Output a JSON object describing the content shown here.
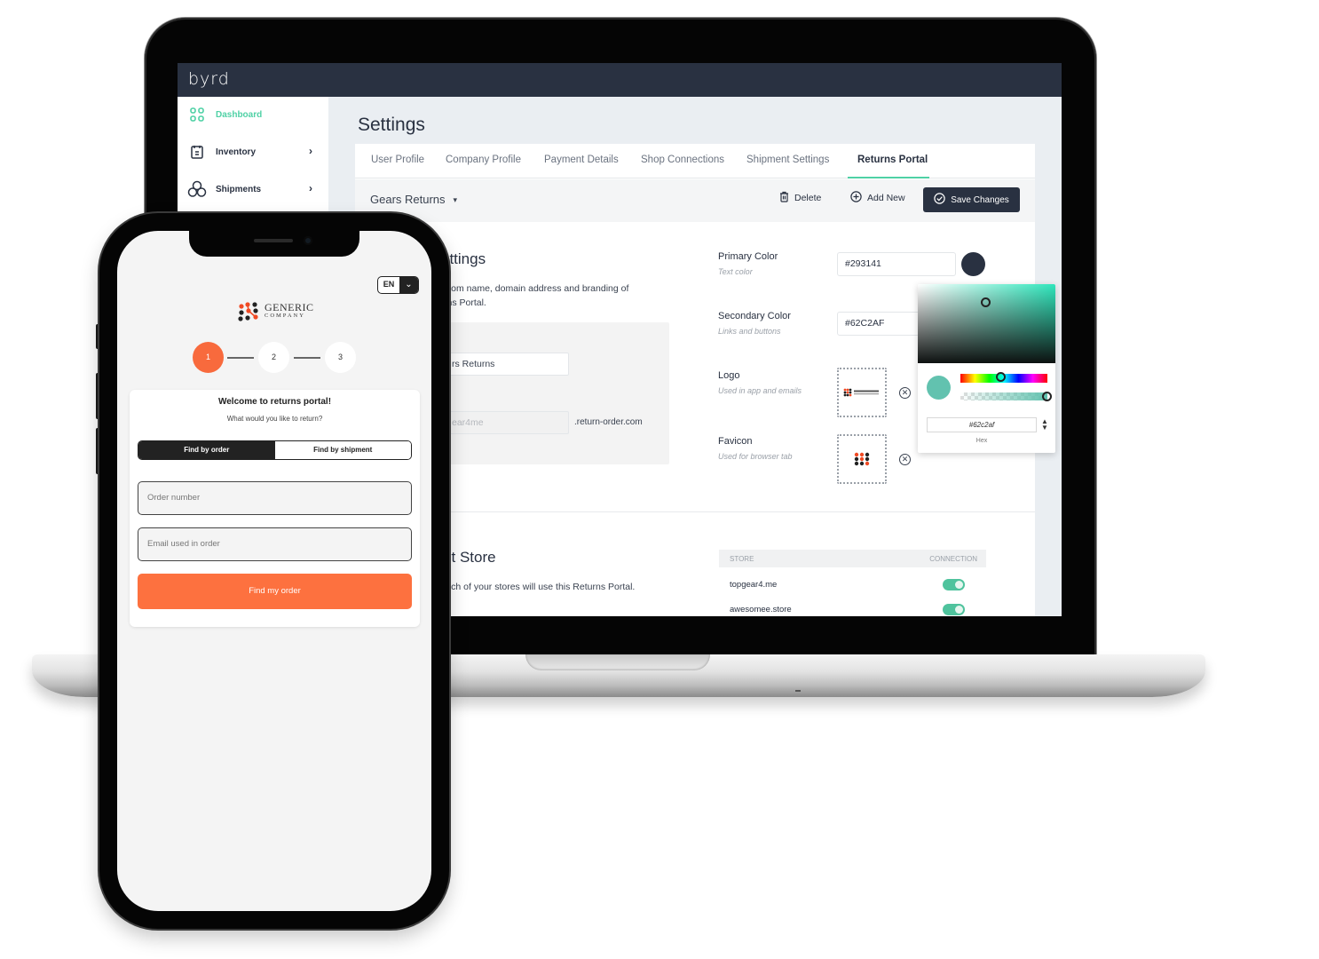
{
  "desktop": {
    "app_logo": "byrd",
    "sidebar": {
      "items": [
        {
          "label": "Dashboard",
          "icon": "dashboard-grid-icon",
          "active": true
        },
        {
          "label": "Inventory",
          "icon": "inventory-clipboard-icon",
          "has_children": true
        },
        {
          "label": "Shipments",
          "icon": "shipments-boxes-icon",
          "has_children": true
        }
      ],
      "chevron": "›"
    },
    "page_title": "Settings",
    "tabs": [
      {
        "label": "User Profile"
      },
      {
        "label": "Company Profile"
      },
      {
        "label": "Payment Details"
      },
      {
        "label": "Shop Connections"
      },
      {
        "label": "Shipment Settings"
      },
      {
        "label": "Returns Portal",
        "active": true
      }
    ],
    "toolbar": {
      "portal_select": "Gears Returns",
      "caret": "▾",
      "delete_label": "Delete",
      "add_new_label": "Add New",
      "save_label": "Save Changes"
    },
    "portal_settings": {
      "title_visible": "ettings",
      "desc_line1": "stom name, domain address and branding of",
      "desc_line2": "rns Portal.",
      "name_value": "rs Returns",
      "domain_placeholder": "ear4me",
      "domain_suffix": ".return-order.com"
    },
    "branding": {
      "primary_label": "Primary Color",
      "primary_sub": "Text color",
      "primary_value": "#293141",
      "secondary_label": "Secondary Color",
      "secondary_sub": "Links and buttons",
      "secondary_value": "#62C2AF",
      "logo_label": "Logo",
      "logo_sub": "Used in app and emails",
      "favicon_label": "Favicon",
      "favicon_sub": "Used for browser tab",
      "remove_glyph": "✕"
    },
    "color_picker": {
      "hex_value": "#62c2af",
      "hex_label": "Hex",
      "stepper": "▲▼",
      "alpha_percent": 100
    },
    "connect_store": {
      "title_visible": "ct Store",
      "desc_visible": "hich of your stores will use this Returns Portal.",
      "col_store": "STORE",
      "col_connection": "CONNECTION",
      "stores": [
        {
          "name": "topgear4.me",
          "connected": true
        },
        {
          "name": "awesomee.store",
          "connected": true
        }
      ]
    }
  },
  "mobile": {
    "language": "EN",
    "lang_caret": "⌄",
    "brand_line1": "GENERIC",
    "brand_line2": "COMPANY",
    "steps": [
      "1",
      "2",
      "3"
    ],
    "current_step": 1,
    "welcome_title": "Welcome to returns portal!",
    "welcome_sub": "What would you like to return?",
    "seg_order": "Find by order",
    "seg_shipment": "Find by shipment",
    "order_placeholder": "Order number",
    "email_placeholder": "Email used in order",
    "find_button": "Find my order"
  },
  "colors": {
    "primary": "#293141",
    "secondary": "#62C2AF",
    "accent_green": "#4fd1a5",
    "mobile_accent": "#fd713f"
  }
}
